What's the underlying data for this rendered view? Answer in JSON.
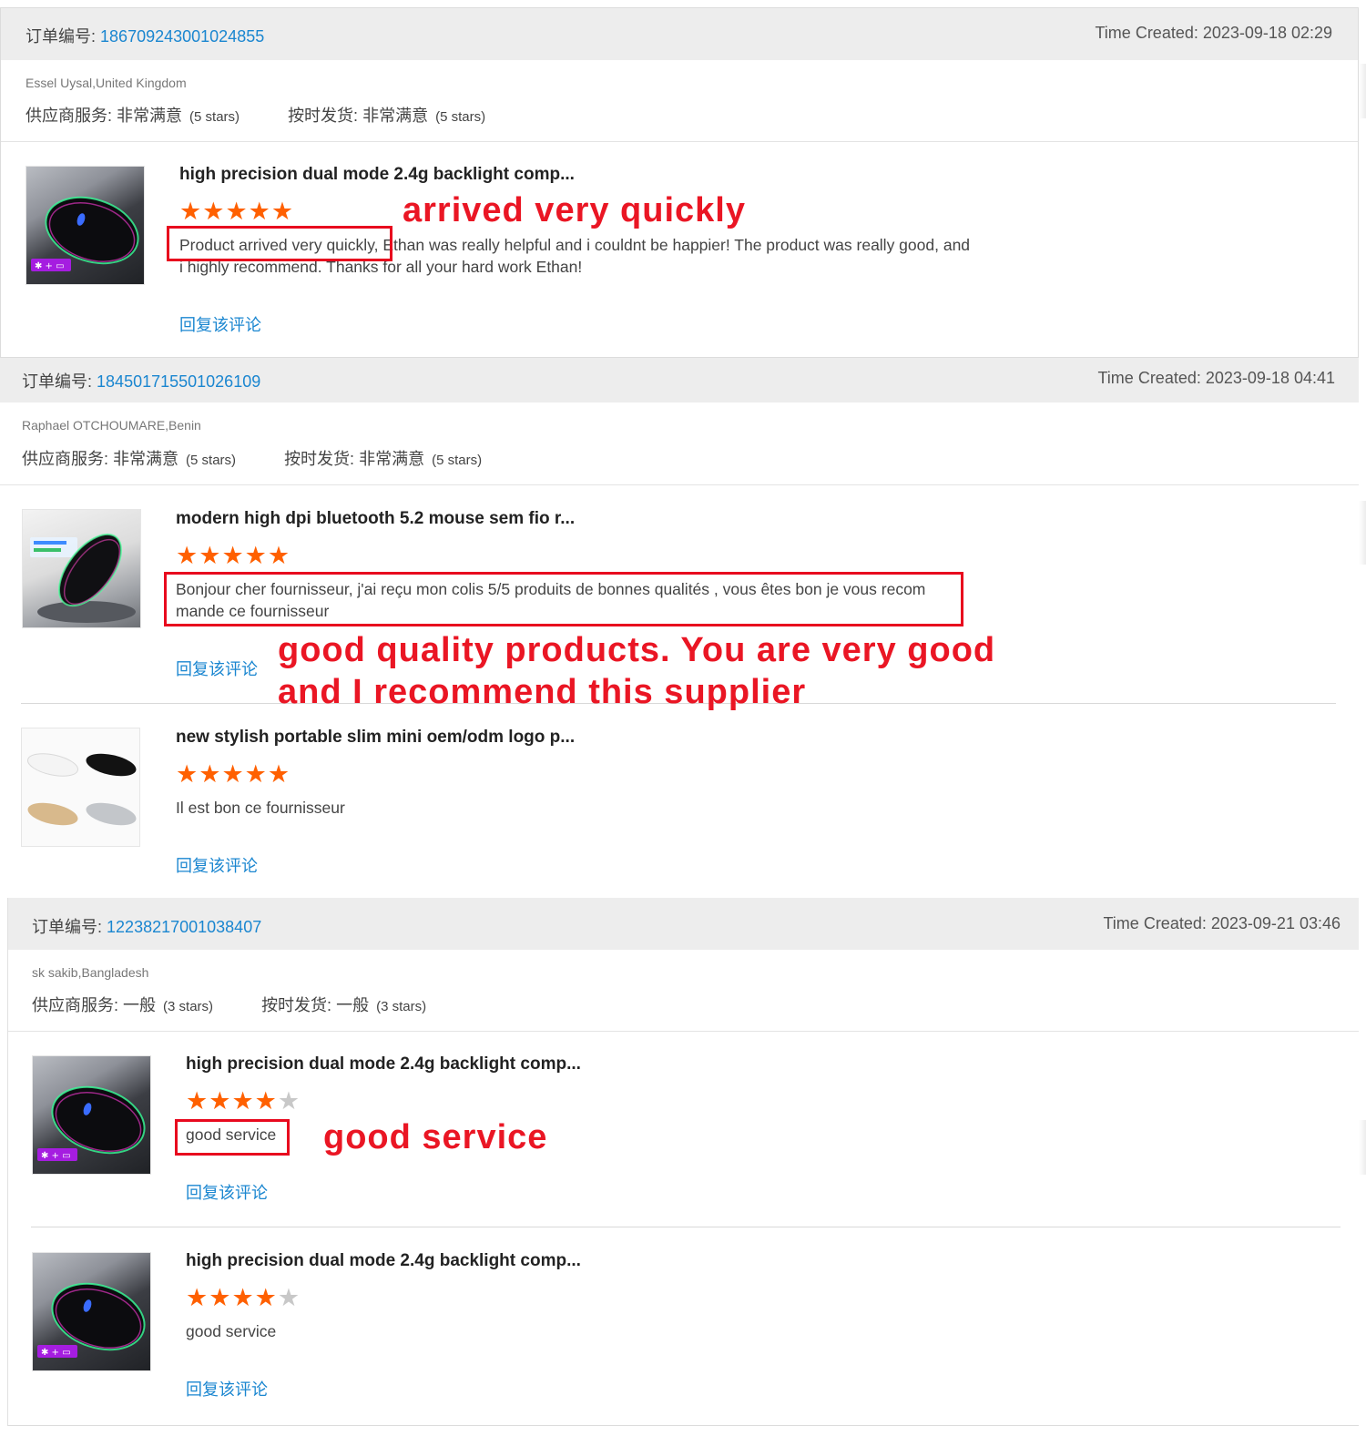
{
  "labels": {
    "order_no": "订单编号:",
    "time_created": "Time Created:",
    "reply": "回复该评论"
  },
  "orders": [
    {
      "order_number": "186709243001024855",
      "time_created": "2023-09-18 02:29",
      "buyer": "Essel Uysal,United Kingdom",
      "supplier_service": {
        "label": "供应商服务:",
        "value": "非常满意",
        "stars": "(5 stars)"
      },
      "on_time_shipment": {
        "label": "按时发货:",
        "value": "非常满意",
        "stars": "(5 stars)"
      },
      "products": [
        {
          "title": "high precision dual mode 2.4g backlight comp...",
          "rating": 5,
          "review": "Product arrived very quickly, Ethan was really helpful and i couldnt be happier! The product was really good, and i highly recommend. Thanks for all your hard work Ethan!",
          "annotation": "arrived very quickly"
        }
      ]
    },
    {
      "order_number": "184501715501026109",
      "time_created": "2023-09-18 04:41",
      "buyer": "Raphael OTCHOUMARE,Benin",
      "supplier_service": {
        "label": "供应商服务:",
        "value": "非常满意",
        "stars": "(5 stars)"
      },
      "on_time_shipment": {
        "label": "按时发货:",
        "value": "非常满意",
        "stars": "(5 stars)"
      },
      "products": [
        {
          "title": "modern high dpi bluetooth 5.2 mouse sem fio r...",
          "rating": 5,
          "review": "Bonjour cher fournisseur, j'ai reçu mon colis 5/5 produits de bonnes qualités , vous êtes bon je vous recom mande ce fournisseur",
          "annotation_line1": "good quality products. You are very good",
          "annotation_line2": "and I recommend this supplier"
        },
        {
          "title": "new stylish portable slim mini oem/odm logo p...",
          "rating": 5,
          "review": "Il est bon ce fournisseur"
        }
      ]
    },
    {
      "order_number": "12238217001038407",
      "time_created": "2023-09-21 03:46",
      "buyer": "sk sakib,Bangladesh",
      "supplier_service": {
        "label": "供应商服务:",
        "value": "一般",
        "stars": "(3 stars)"
      },
      "on_time_shipment": {
        "label": "按时发货:",
        "value": "一般",
        "stars": "(3 stars)"
      },
      "products": [
        {
          "title": "high precision dual mode 2.4g backlight comp...",
          "rating": 4,
          "review": "good service",
          "annotation": "good service"
        },
        {
          "title": "high precision dual mode 2.4g backlight comp...",
          "rating": 4,
          "review": "good service"
        }
      ]
    }
  ],
  "colors": {
    "link": "#1a86d0",
    "star": "#ff6000",
    "star_empty": "#c8c8c8",
    "annotation": "#ea1624",
    "header_bg": "#ededed"
  },
  "icons": [
    "star-icon",
    "bluetooth-dual-mode-badge"
  ]
}
